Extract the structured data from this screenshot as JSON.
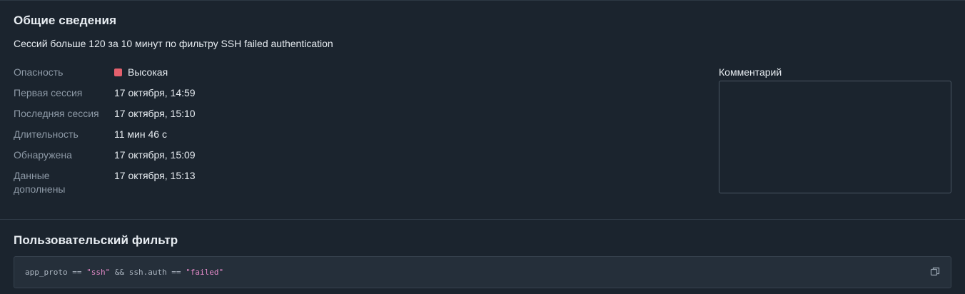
{
  "general": {
    "title": "Общие сведения",
    "subtitle": "Сессий больше 120 за 10 минут по фильтру SSH failed authentication",
    "properties": [
      {
        "label": "Опасность",
        "value": "Высокая"
      },
      {
        "label": "Первая сессия",
        "value": "17 октября, 14:59"
      },
      {
        "label": "Последняя сессия",
        "value": "17 октября, 15:10"
      },
      {
        "label": "Длительность",
        "value": "11 мин 46 с"
      },
      {
        "label": "Обнаружена",
        "value": "17 октября, 15:09"
      },
      {
        "label": "Данные дополнены",
        "value": "17 октября, 15:13"
      }
    ],
    "severity_color": "#e4606d",
    "comment": {
      "label": "Комментарий",
      "value": ""
    }
  },
  "custom_filter": {
    "title": "Пользовательский фильтр",
    "code": {
      "part1": "app_proto == ",
      "str1": "\"ssh\"",
      "part2": " && ssh.auth == ",
      "str2": "\"failed\""
    },
    "copy_icon": "copy-icon"
  }
}
